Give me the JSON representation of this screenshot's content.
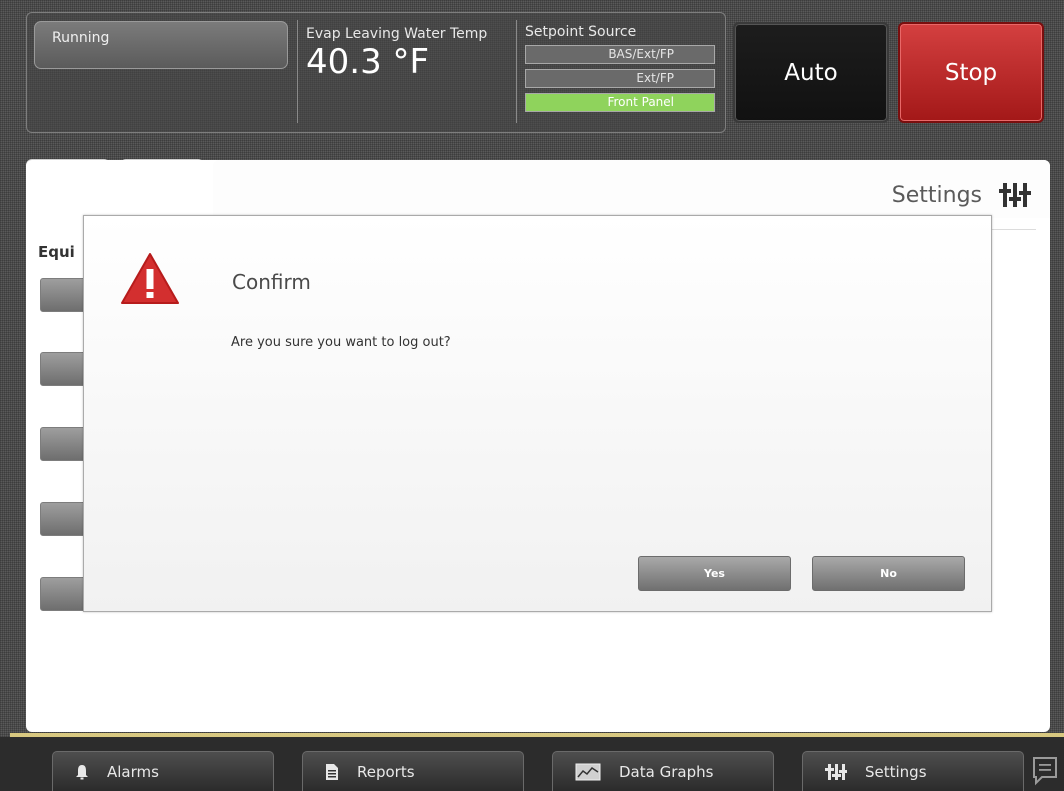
{
  "header": {
    "status": "Running",
    "evap_label": "Evap Leaving Water Temp",
    "evap_value": "40.3 °F",
    "setpoint_label": "Setpoint Source",
    "setpoint_options": [
      "BAS/Ext/FP",
      "Ext/FP",
      "Front Panel"
    ],
    "setpoint_selected": "Front Panel",
    "auto_label": "Auto",
    "stop_label": "Stop"
  },
  "nav": {
    "back_icon": "back-arrow-icon",
    "home_icon": "home-icon"
  },
  "page": {
    "title": "Settings",
    "title_icon": "settings-sliders-icon",
    "heading": "Equi"
  },
  "modal": {
    "icon": "warning-icon",
    "title": "Confirm",
    "message": "Are you sure you want to log out?",
    "yes_label": "Yes",
    "no_label": "No"
  },
  "bottom_tabs": [
    {
      "label": "Alarms",
      "icon": "bell-icon"
    },
    {
      "label": "Reports",
      "icon": "document-icon"
    },
    {
      "label": "Data Graphs",
      "icon": "graph-icon"
    },
    {
      "label": "Settings",
      "icon": "settings-sliders-icon"
    }
  ],
  "colors": {
    "stop": "#c62828",
    "selected_source": "#8fd35c",
    "warning": "#d32f2f"
  }
}
